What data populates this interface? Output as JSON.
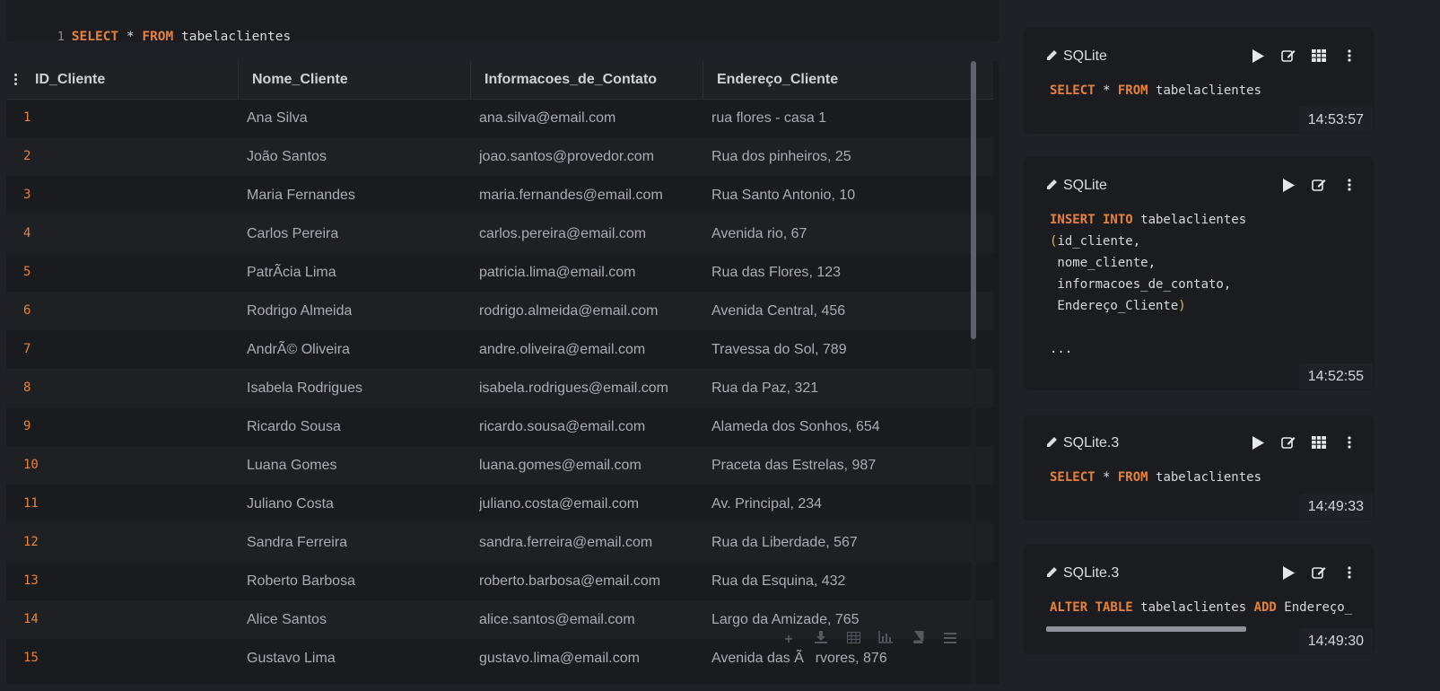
{
  "editor": {
    "line_number": "1",
    "query_keyword_1": "SELECT",
    "query_mid": " * ",
    "query_keyword_2": "FROM",
    "query_table": " tabelaclientes"
  },
  "grid": {
    "columns": [
      "ID_Cliente",
      "Nome_Cliente",
      "Informacoes_de_Contato",
      "Endereço_Cliente"
    ],
    "rows": [
      [
        "1",
        "Ana Silva",
        "ana.silva@email.com",
        "rua flores - casa 1"
      ],
      [
        "2",
        "João Santos",
        "joao.santos@provedor.com",
        "Rua dos pinheiros, 25"
      ],
      [
        "3",
        "Maria Fernandes",
        "maria.fernandes@email.com",
        "Rua Santo Antonio, 10"
      ],
      [
        "4",
        "Carlos Pereira",
        "carlos.pereira@email.com",
        "Avenida rio, 67"
      ],
      [
        "5",
        "PatrÃcia Lima",
        "patricia.lima@email.com",
        "Rua das Flores, 123"
      ],
      [
        "6",
        "Rodrigo Almeida",
        "rodrigo.almeida@email.com",
        "Avenida Central, 456"
      ],
      [
        "7",
        "AndrÃ© Oliveira",
        "andre.oliveira@email.com",
        "Travessa do Sol, 789"
      ],
      [
        "8",
        "Isabela Rodrigues",
        "isabela.rodrigues@email.com",
        "Rua da Paz, 321"
      ],
      [
        "9",
        "Ricardo Sousa",
        "ricardo.sousa@email.com",
        "Alameda dos Sonhos, 654"
      ],
      [
        "10",
        "Luana Gomes",
        "luana.gomes@email.com",
        "Praceta das Estrelas, 987"
      ],
      [
        "11",
        "Juliano Costa",
        "juliano.costa@email.com",
        "Av. Principal, 234"
      ],
      [
        "12",
        "Sandra Ferreira",
        "sandra.ferreira@email.com",
        "Rua da Liberdade, 567"
      ],
      [
        "13",
        "Roberto Barbosa",
        "roberto.barbosa@email.com",
        "Rua da Esquina, 432"
      ],
      [
        "14",
        "Alice Santos",
        "alice.santos@email.com",
        "Largo da Amizade, 765"
      ],
      [
        "15",
        "Gustavo Lima",
        "gustavo.lima@email.com",
        "Avenida das Ãrvores, 876"
      ]
    ],
    "toolbar_icons": [
      "plus-icon",
      "download-icon",
      "table-icon",
      "bar-chart-icon",
      "book-icon",
      "menu-icon"
    ]
  },
  "history": [
    {
      "engine": "SQLite",
      "time": "14:53:57"
    },
    {
      "engine": "SQLite",
      "time": "14:52:55"
    },
    {
      "engine": "SQLite.3",
      "time": "14:49:33"
    },
    {
      "engine": "SQLite.3",
      "time": "14:49:30"
    }
  ],
  "history_code": {
    "c1": {
      "kw1": "SELECT",
      "mid": " * ",
      "kw2": "FROM",
      "rest": " tabelaclientes"
    },
    "c2": {
      "kw": "INSERT INTO",
      "table": " tabelaclientes",
      "open": "(",
      "l2": "id_cliente,",
      "l3": " nome_cliente,",
      "l4": " informacoes_de_contato,",
      "l5": " Endereço_Cliente",
      "close": ")",
      "ellipsis": "..."
    },
    "c3": {
      "kw1": "SELECT",
      "mid": " * ",
      "kw2": "FROM",
      "rest": " tabelaclientes"
    },
    "c4": {
      "kw1": "ALTER TABLE",
      "mid": " tabelaclientes ",
      "kw2": "ADD",
      "rest": " Endereço_"
    }
  },
  "colors": {
    "keyword": "#e8823a",
    "background": "#202126",
    "panel": "#1b1c20"
  }
}
